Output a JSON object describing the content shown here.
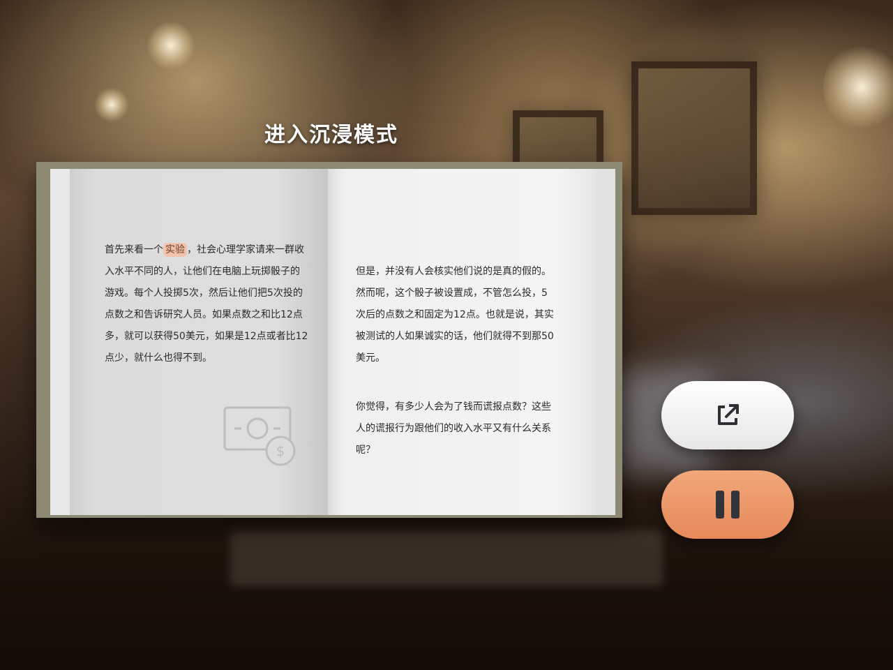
{
  "header": {
    "title": "进入沉浸模式"
  },
  "book": {
    "left_page": {
      "text_before_highlight": "首先来看一个",
      "highlight": "实验",
      "text_after_highlight": "，社会心理学家请来一群收入水平不同的人，让他们在电脑上玩掷骰子的游戏。每个人投掷5次，然后让他们把5次投的点数之和告诉研究人员。如果点数之和比12点多，就可以获得50美元，如果是12点或者比12点少，就什么也得不到。",
      "icon": "money-bill-dollar-icon"
    },
    "right_page": {
      "paragraph_1": "但是，并没有人会核实他们说的是真的假的。然而呢，这个骰子被设置成，不管怎么投，5次后的点数之和固定为12点。也就是说，其实被测试的人如果诚实的话，他们就得不到那50美元。",
      "paragraph_2": "你觉得，有多少人会为了钱而谎报点数？这些人的谎报行为跟他们的收入水平又有什么关系呢？"
    }
  },
  "controls": {
    "share_icon": "external-link-icon",
    "pause_icon": "pause-icon",
    "pause_color": "#e98e5f",
    "share_color": "#f2f2f2"
  }
}
